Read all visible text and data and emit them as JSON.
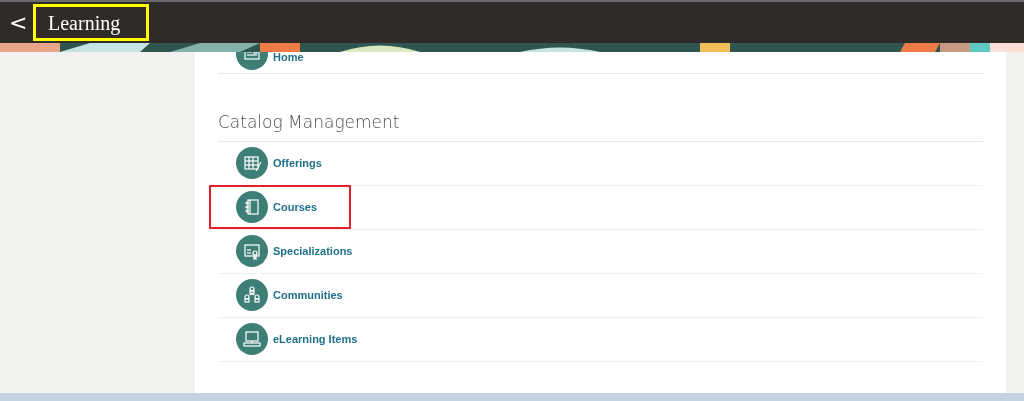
{
  "header": {
    "back": "<",
    "title": "Learning",
    "highlighted": true
  },
  "top_item": {
    "label": "Home",
    "kind": "home"
  },
  "section": {
    "title": "Catalog Management",
    "items": [
      {
        "label": "Offerings",
        "kind": "calendar",
        "highlighted": false
      },
      {
        "label": "Courses",
        "kind": "notebook",
        "highlighted": true
      },
      {
        "label": "Specializations",
        "kind": "certificate",
        "highlighted": false
      },
      {
        "label": "Communities",
        "kind": "people",
        "highlighted": false
      },
      {
        "label": "eLearning Items",
        "kind": "computer",
        "highlighted": false
      }
    ]
  }
}
